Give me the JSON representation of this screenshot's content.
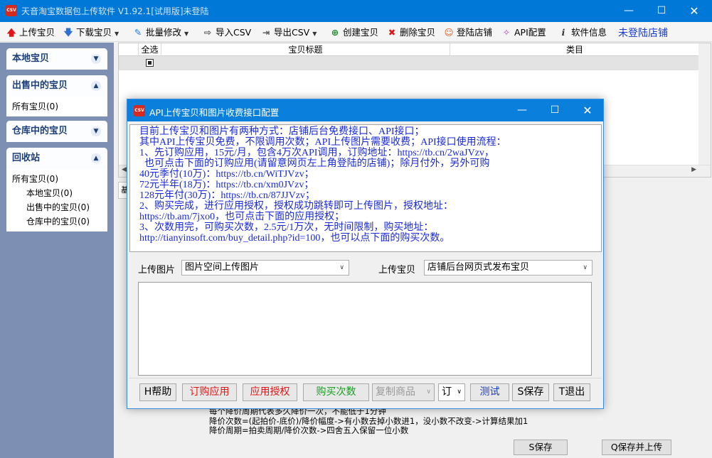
{
  "window": {
    "title": "天音淘宝数据包上传软件 V1.92.1[试用版]未登陆",
    "icon_text": "CSV"
  },
  "toolbar": {
    "upload": "上传宝贝",
    "download": "下载宝贝",
    "batch_edit": "批量修改",
    "import_csv": "导入CSV",
    "export_csv": "导出CSV",
    "create": "创建宝贝",
    "delete": "删除宝贝",
    "login_shop": "登陆店铺",
    "api_config": "API配置",
    "soft_info": "软件信息",
    "status_link": "未登陆店铺"
  },
  "sidebar": {
    "local": {
      "title": "本地宝贝"
    },
    "selling": {
      "title": "出售中的宝贝",
      "items": [
        "所有宝贝(0)"
      ]
    },
    "warehouse": {
      "title": "仓库中的宝贝"
    },
    "recycle": {
      "title": "回收站",
      "items": [
        "所有宝贝(0)",
        "本地宝贝(0)",
        "出售中的宝贝(0)",
        "仓库中的宝贝(0)"
      ]
    }
  },
  "grid": {
    "columns": [
      "全选",
      "宝贝标题",
      "类目"
    ]
  },
  "lower": {
    "tab_label": "基",
    "help_lines": [
      "每个降价周期代表多久降价一次，不能低于1分钟",
      "降价次数=(起拍价-底价)/降价幅度->有小数去掉小数进1，没小数不改变->计算结果加1",
      "降价周期=拍卖周期/降价次数->四舍五入保留一位小数"
    ],
    "save_btn": "S保存",
    "save_upload_btn": "Q保存并上传"
  },
  "dialog": {
    "title": "API上传宝贝和图片收费接口配置",
    "icon_text": "CSV",
    "info_lines": [
      "目前上传宝贝和图片有两种方式：店铺后台免费接口、API接口；",
      "其中API上传宝贝免费，不限调用次数；API上传图片需要收费；API接口使用流程：",
      "1、先订购应用，15元/月，包含4万次API调用，订购地址：https://tb.cn/2waJVzv，",
      "  也可点击下面的订购应用(请留意网页左上角登陆的店铺)；除月付外，另外可购",
      "40元季付(10万)：https://tb.cn/WiTJVzv；",
      "72元半年(18万)：https://tb.cn/xm0JVzv；",
      "128元年付(30万)：https://tb.cn/87JJVzv；",
      "2、购买完成，进行应用授权，授权成功跳转即可上传图片，授权地址：",
      "https://tb.am/7jxo0，也可点击下面的应用授权；",
      "3、次数用完，可购买次数，2.5元/1万次，无时间限制，购买地址：",
      "http://tianyinsoft.com/buy_detail.php?id=100，也可以点下面的购买次数。"
    ],
    "upload_image_label": "上传图片",
    "upload_image_value": "图片空间上传图片",
    "upload_item_label": "上传宝贝",
    "upload_item_value": "店铺后台网页式发布宝贝",
    "buttons": {
      "help": "H帮助",
      "order_app": "订购应用",
      "app_auth": "应用授权",
      "buy_count": "购买次数",
      "copy_goods": "复制商品",
      "order_select": "订",
      "test": "测试",
      "save": "S保存",
      "exit": "T退出"
    }
  },
  "colors": {
    "titlebar": "#0078d7",
    "sidebar_bg": "#7d8fb2",
    "info_text": "#1a2ad8",
    "red_button": "#e01616",
    "green_button": "#1a9c22",
    "blue_button": "#1a3bcb"
  }
}
